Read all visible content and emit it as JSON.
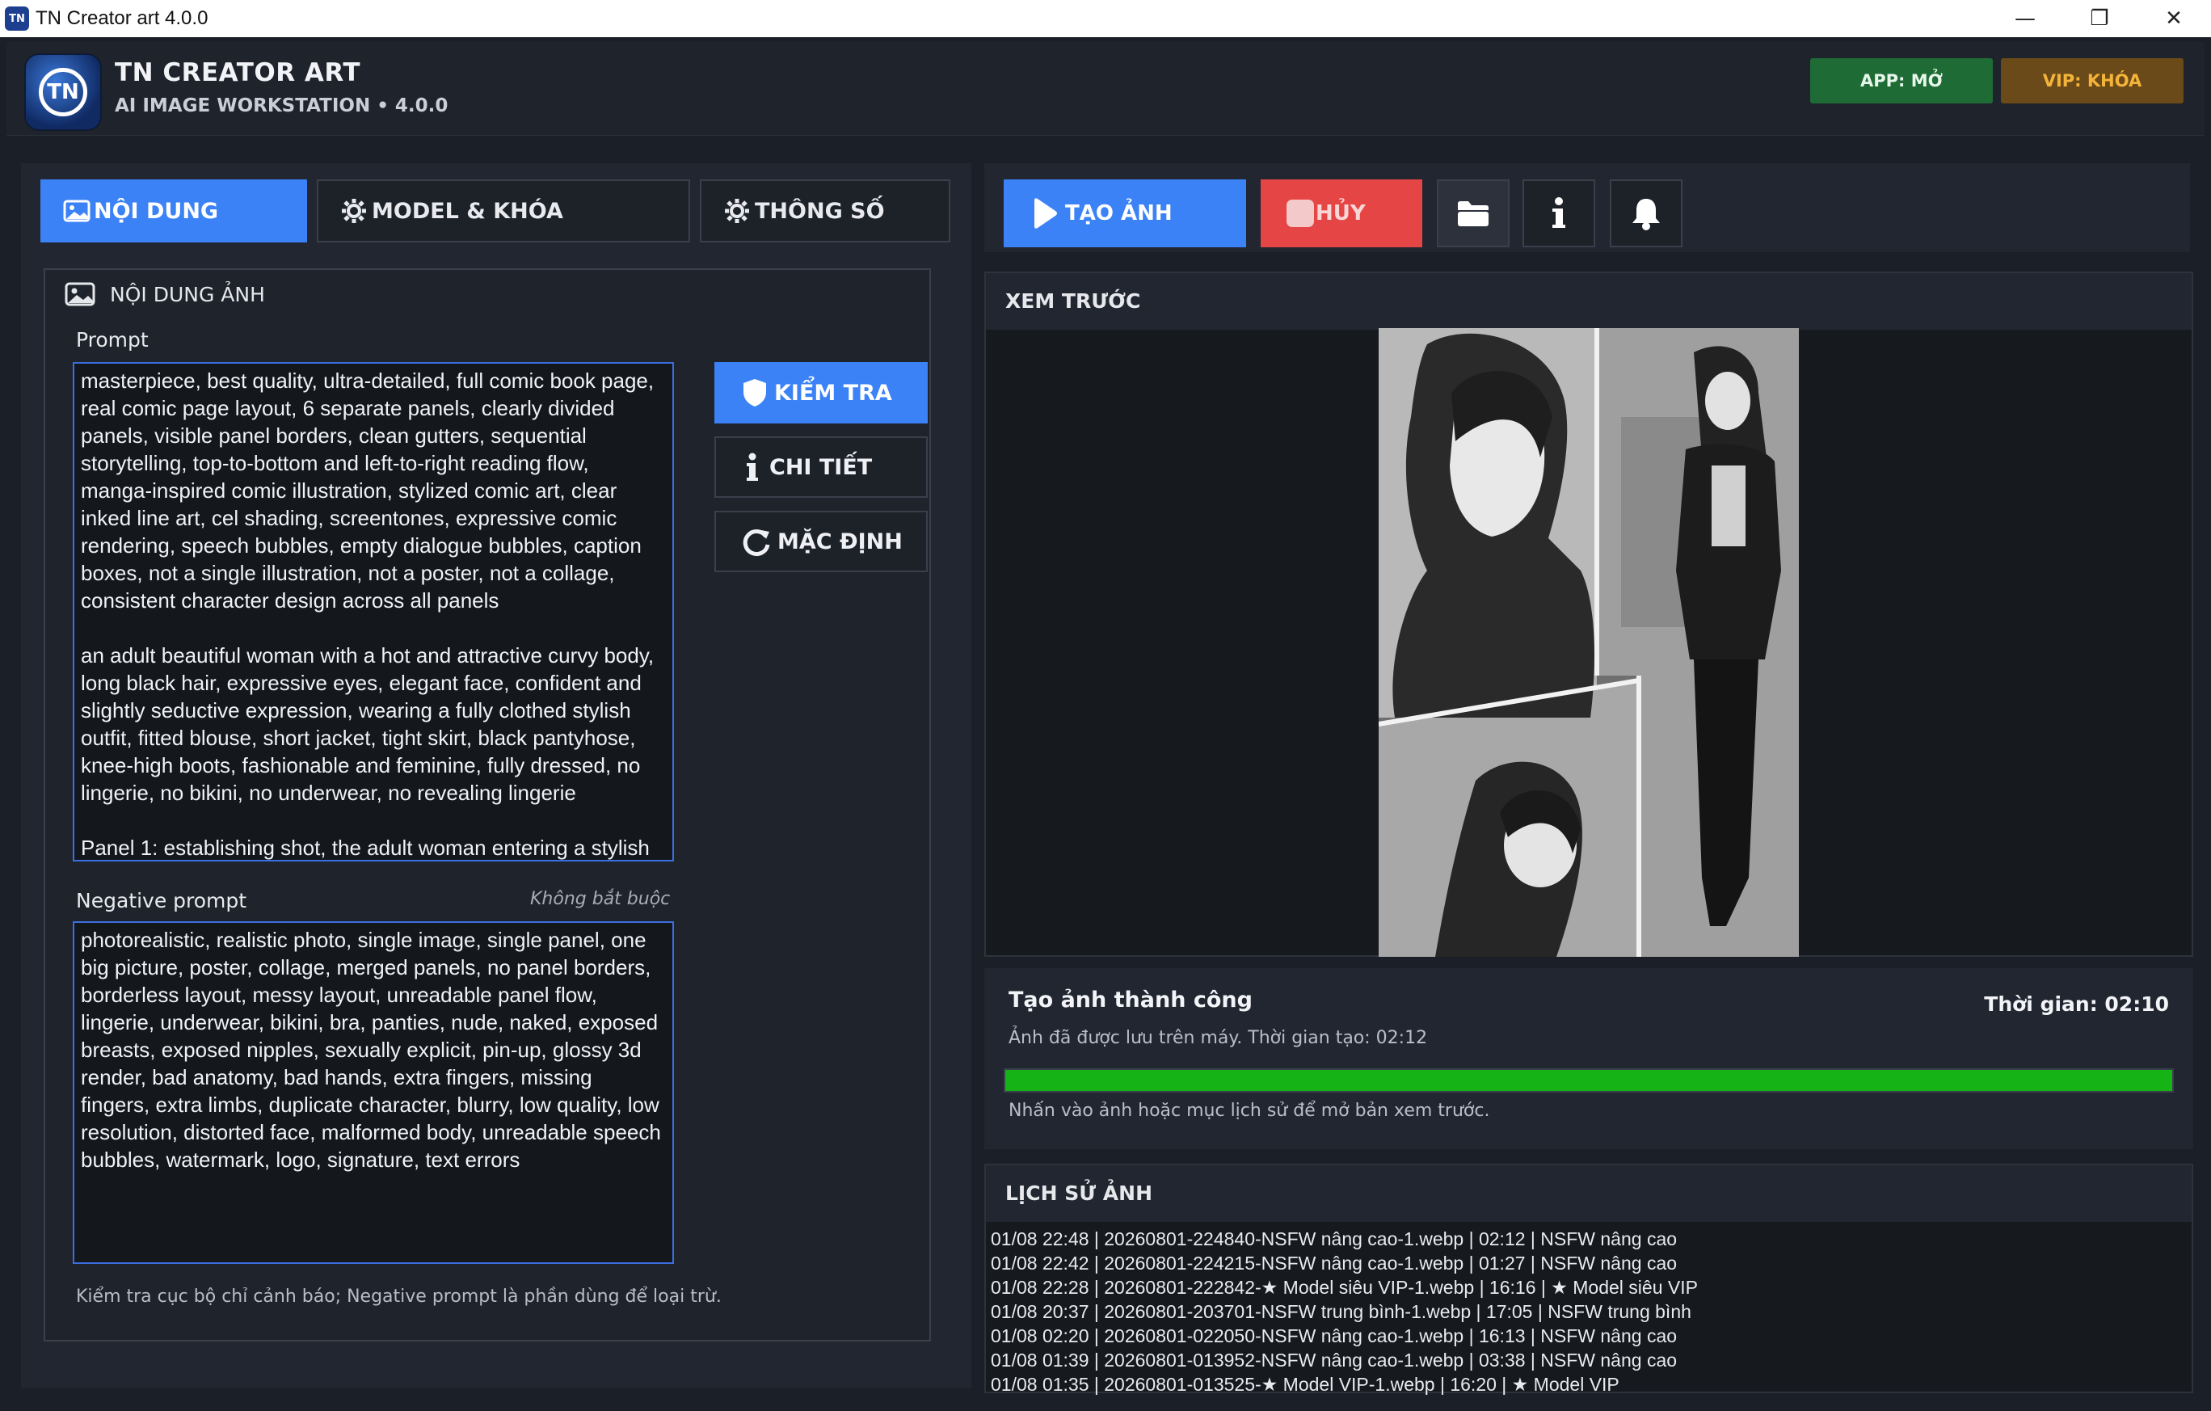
{
  "window": {
    "title": "TN Creator art 4.0.0",
    "minimize": "—",
    "maximize": "❐",
    "close": "✕"
  },
  "header": {
    "logo_text": "TN",
    "title": "TN CREATOR ART",
    "subtitle": "AI IMAGE WORKSTATION  •  4.0.0",
    "app_badge": "APP: MỞ",
    "vip_badge": "VIP: KHÓA",
    "app_badge_color": "#1f6b36",
    "vip_badge_color": "#6b4a1a"
  },
  "tabs": [
    {
      "label": "NỘI DUNG",
      "icon": "image-icon",
      "active": true
    },
    {
      "label": "MODEL & KHÓA",
      "icon": "gear-icon",
      "active": false
    },
    {
      "label": "THÔNG SỐ",
      "icon": "gear-icon",
      "active": false
    }
  ],
  "content": {
    "section_title": "NỘI DUNG ẢNH",
    "prompt_label": "Prompt",
    "prompt_paragraphs": [
      "masterpiece, best quality, ultra-detailed, full comic book page, real comic page layout, 6 separate panels, clearly divided panels, visible panel borders, clean gutters, sequential storytelling, top-to-bottom and left-to-right reading flow, manga-inspired comic illustration, stylized comic art, clear inked line art, cel shading, screentones, expressive comic rendering, speech bubbles, empty dialogue bubbles, caption boxes, not a single illustration, not a poster, not a collage, consistent character design across all panels",
      "an adult beautiful woman with a hot and attractive curvy body, long black hair, expressive eyes, elegant face, confident and slightly seductive expression, wearing a fully clothed stylish outfit, fitted blouse, short jacket, tight skirt, black pantyhose, knee-high boots, fashionable and feminine, fully dressed, no lingerie, no bikini, no underwear, no revealing lingerie",
      "Panel 1: establishing shot, the adult woman entering a stylish"
    ],
    "negative_label": "Negative prompt",
    "negative_hint": "Không bắt buộc",
    "negative_text": "photorealistic, realistic photo, single image, single panel, one big picture, poster, collage, merged panels, no panel borders, borderless layout, messy layout, unreadable panel flow, lingerie, underwear, bikini, bra, panties, nude, naked, exposed breasts, exposed nipples, sexually explicit, pin-up, glossy 3d render, bad anatomy, bad hands, extra fingers, missing fingers, extra limbs, duplicate character, blurry, low quality, low resolution, distorted face, malformed body, unreadable speech bubbles, watermark, logo, signature, text errors",
    "footer_note": "Kiểm tra cục bộ chỉ cảnh báo; Negative prompt là phần dùng để loại trừ.",
    "check_button": "KIỂM TRA",
    "detail_button": "CHI TIẾT",
    "default_button": "MẶC ĐỊNH"
  },
  "toolbar": {
    "create_label": "TẠO ẢNH",
    "cancel_label": "HỦY",
    "create_color": "#3b82f6",
    "cancel_color": "#e64545"
  },
  "preview": {
    "title": "XEM TRƯỚC"
  },
  "status": {
    "title": "Tạo ảnh thành công",
    "time": "Thời gian: 02:10",
    "message": "Ảnh đã được lưu trên máy. Thời gian tạo: 02:12",
    "progress": 1.0,
    "progress_color": "#16b317",
    "hint": "Nhấn vào ảnh hoặc mục lịch sử để mở bản xem trước."
  },
  "history": {
    "title": "LỊCH SỬ ẢNH",
    "rows": [
      "01/08 22:48  |  20260801-224840-NSFW nâng cao-1.webp  |  02:12  |  NSFW nâng cao",
      "01/08 22:42  |  20260801-224215-NSFW nâng cao-1.webp  |  01:27  |  NSFW nâng cao",
      "01/08 22:28  |  20260801-222842-★ Model siêu VIP-1.webp  |  16:16  |  ★ Model siêu VIP",
      "01/08 20:37  |  20260801-203701-NSFW trung bình-1.webp  |  17:05  |  NSFW trung bình",
      "01/08 02:20  |  20260801-022050-NSFW nâng cao-1.webp  |  16:13  |  NSFW nâng cao",
      "01/08 01:39  |  20260801-013952-NSFW nâng cao-1.webp  |  03:38  |  NSFW nâng cao",
      "01/08 01:35  |  20260801-013525-★ Model VIP-1.webp  |  16:20  |  ★ Model VIP"
    ]
  }
}
